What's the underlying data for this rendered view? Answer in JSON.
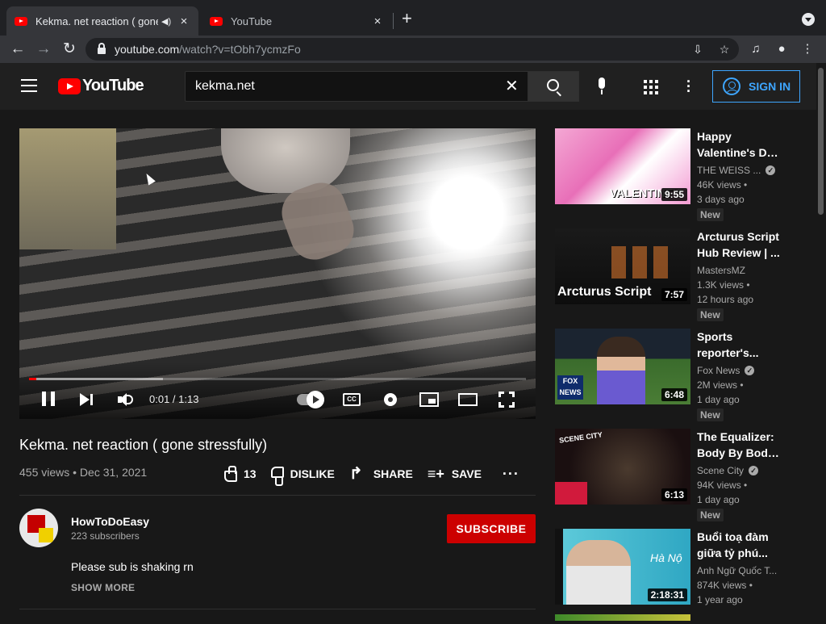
{
  "browser": {
    "tabs": [
      {
        "title": "Kekma. net reaction ( gone stressfully)",
        "active": true,
        "close": "×"
      },
      {
        "title": "YouTube",
        "active": false,
        "close": "×"
      }
    ],
    "new_tab": "+",
    "url_host": "youtube.com",
    "url_path": "/watch?v=tObh7ycmzFo",
    "nav": {
      "back": "←",
      "forward": "→",
      "reload": "↻"
    }
  },
  "header": {
    "logo_text": "YouTube",
    "search_value": "kekma.net",
    "clear": "✕",
    "signin_label": "SIGN IN"
  },
  "player": {
    "time": "0:01 / 1:13",
    "progress_played": 0.014,
    "progress_buffered": 0.27,
    "cc_label": "CC"
  },
  "video": {
    "title": "Kekma. net reaction ( gone stressfully)",
    "meta": "455 views • Dec 31, 2021",
    "likes": "13",
    "dislike_label": "DISLIKE",
    "share_label": "SHARE",
    "save_label": "SAVE",
    "more": "···"
  },
  "channel": {
    "name": "HowToDoEasy",
    "subscribers": "223 subscribers",
    "subscribe_label": "SUBSCRIBE",
    "description": "Please sub is shaking rn",
    "show_more": "SHOW MORE"
  },
  "recommendations": [
    {
      "title_1": "Happy",
      "title_2": "Valentine's Da...",
      "channel": "THE WEISS ...",
      "verified": true,
      "views": "46K views •",
      "age": "3 days ago",
      "badge": "New",
      "duration": "9:55",
      "thumb_text": "VALENTINE'S"
    },
    {
      "title_1": "Arcturus Script",
      "title_2": "Hub Review | ...",
      "channel": "MastersMZ",
      "verified": false,
      "views": "1.3K views •",
      "age": "12 hours ago",
      "badge": "New",
      "duration": "7:57",
      "thumb_text": "Arcturus Script"
    },
    {
      "title_1": "Sports",
      "title_2": "reporter's...",
      "channel": "Fox News",
      "verified": true,
      "views": "2M views •",
      "age": "1 day ago",
      "badge": "New",
      "duration": "6:48",
      "thumb_text": "FOX NEWS"
    },
    {
      "title_1": "The Equalizer:",
      "title_2": "Body By Body...",
      "channel": "Scene City",
      "verified": true,
      "views": "94K views •",
      "age": "1 day ago",
      "badge": "New",
      "duration": "6:13",
      "thumb_text": "SCENE CITY"
    },
    {
      "title_1": "Buổi toạ đàm",
      "title_2": "giữa tỷ phú...",
      "channel": "Anh Ngữ Quốc T...",
      "verified": false,
      "views": "874K views •",
      "age": "1 year ago",
      "badge": "",
      "duration": "2:18:31",
      "thumb_text": "Hà Nộ"
    }
  ]
}
